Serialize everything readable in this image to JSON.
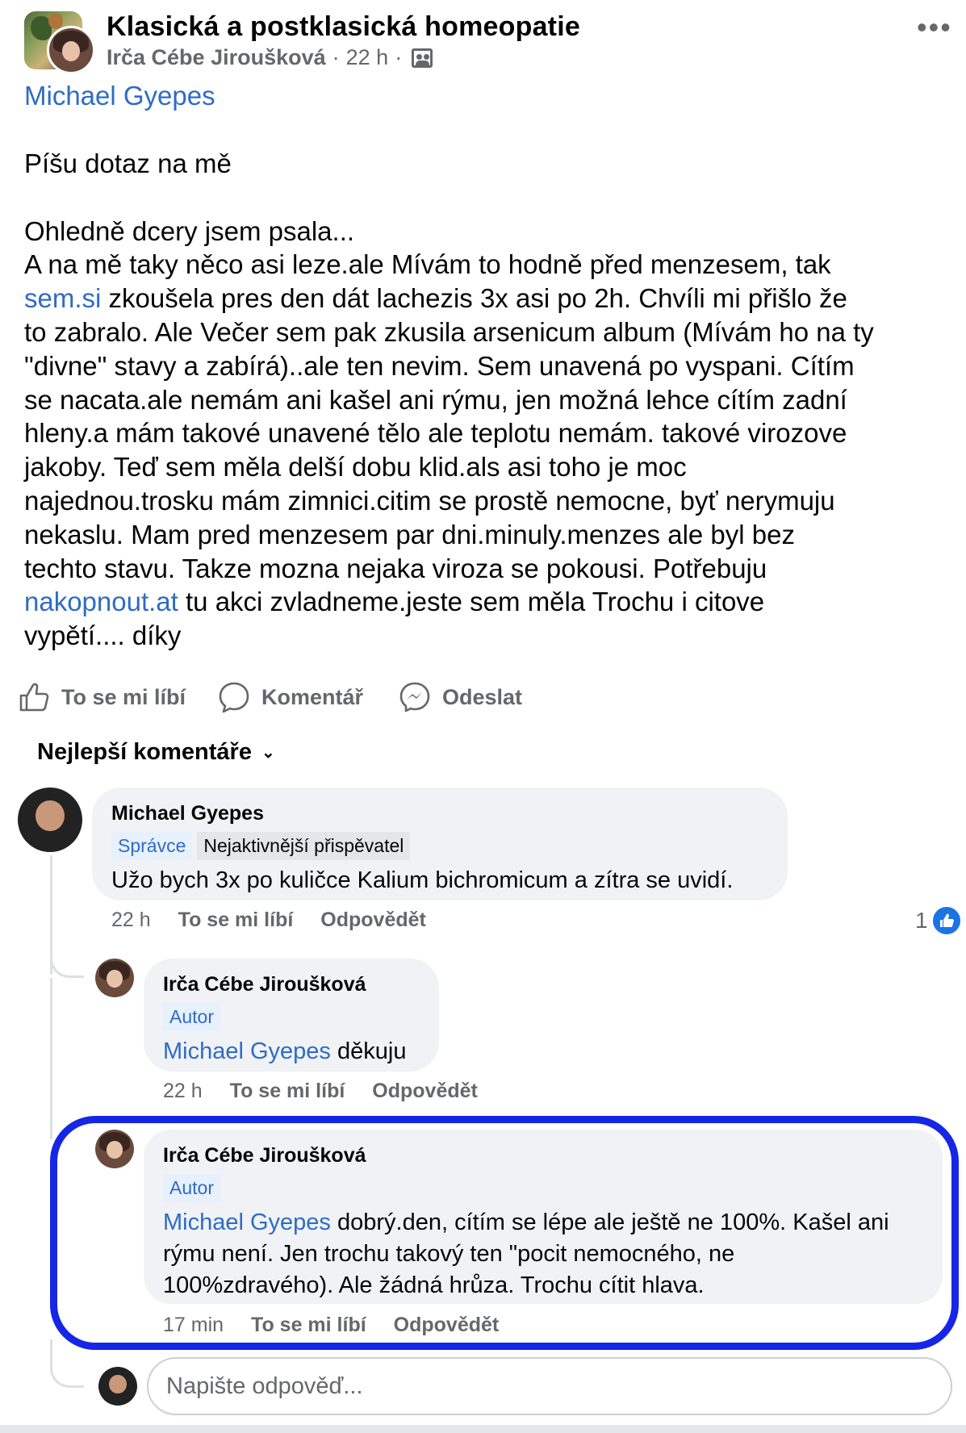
{
  "header": {
    "group_title": "Klasická a postklasická homeopatie",
    "author": "Irča Cébe Jiroušková",
    "time": "22 h",
    "separator": "·"
  },
  "post": {
    "mention": "Michael Gyepes",
    "lines": [
      {
        "parts": [
          {
            "t": "Píšu dotaz na mě"
          }
        ]
      },
      {
        "parts": [
          {
            "t": ""
          }
        ]
      },
      {
        "parts": [
          {
            "t": "Ohledně dcery jsem psala..."
          }
        ]
      },
      {
        "parts": [
          {
            "t": "A na mě taky něco asi leze.ale Mívám to hodně před menzesem, tak"
          }
        ]
      },
      {
        "parts": [
          {
            "t": "sem.si",
            "link": true
          },
          {
            "t": " zkoušela pres den dát lachezis 3x asi po 2h. Chvíli mi přišlo že"
          }
        ]
      },
      {
        "parts": [
          {
            "t": "to zabralo. Ale Večer sem pak zkusila arsenicum album (Mívám ho na ty"
          }
        ]
      },
      {
        "parts": [
          {
            "t": "\"divne\" stavy a zabírá)..ale ten nevim. Sem unavená po vyspani. Cítím"
          }
        ]
      },
      {
        "parts": [
          {
            "t": "se nacata.ale nemám ani kašel ani rýmu, jen možná lehce cítím zadní"
          }
        ]
      },
      {
        "parts": [
          {
            "t": "hleny.a mám takové unavené tělo ale teplotu nemám. takové virozove"
          }
        ]
      },
      {
        "parts": [
          {
            "t": "jakoby. Teď sem měla delší dobu klid.als asi toho je moc"
          }
        ]
      },
      {
        "parts": [
          {
            "t": "najednou.trosku mám zimnici.citim se prostě nemocne, byť nerymuju"
          }
        ]
      },
      {
        "parts": [
          {
            "t": "nekaslu. Mam pred menzesem par dni.minuly.menzes ale byl bez"
          }
        ]
      },
      {
        "parts": [
          {
            "t": "techto stavu. Takze mozna nejaka viroza se pokousi. Potřebuju"
          }
        ]
      },
      {
        "parts": [
          {
            "t": "nakopnout.at",
            "link": true
          },
          {
            "t": " tu akci zvladneme.jeste sem měla Trochu i citove"
          }
        ]
      },
      {
        "parts": [
          {
            "t": "vypětí.... díky"
          }
        ]
      }
    ]
  },
  "actions": {
    "like": "To se mi líbí",
    "comment": "Komentář",
    "send": "Odeslat"
  },
  "comments_filter": "Nejlepší komentáře",
  "comments": [
    {
      "name": "Michael Gyepes",
      "badge1": "Správce",
      "badge2": "Nejaktivnější přispěvatel",
      "text": "Užo bych 3x po kuličce Kalium bichromicum a zítra se uvidí.",
      "time": "22 h",
      "like": "To se mi líbí",
      "reply": "Odpovědět",
      "reaction_count": "1"
    },
    {
      "name": "Irča Cébe Jiroušková",
      "badge1": "Autor",
      "mention": "Michael Gyepes",
      "text": " děkuju",
      "time": "22 h",
      "like": "To se mi líbí",
      "reply": "Odpovědět"
    },
    {
      "name": "Irča Cébe Jiroušková",
      "badge1": "Autor",
      "mention": "Michael Gyepes",
      "line1": " dobrý.den, cítím se lépe ale ještě ne 100%. Kašel ani",
      "line2": "rýmu není. Jen trochu takový ten \"pocit nemocného, ne",
      "line3": "100%zdravého). Ale žádná hrůza. Trochu cítit hlava.",
      "time": "17 min",
      "like": "To se mi líbí",
      "reply": "Odpovědět"
    }
  ],
  "reply_box": {
    "placeholder": "Napište odpověď..."
  },
  "colors": {
    "link": "#2f6cc4",
    "highlight": "#1526e6",
    "like_blue": "#1b74e4"
  }
}
